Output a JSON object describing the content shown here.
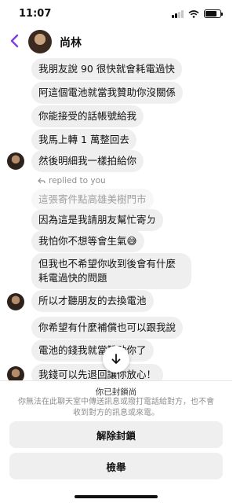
{
  "status": {
    "time": "11:07"
  },
  "header": {
    "name": "尚林",
    "back_icon": "chevron-left-icon"
  },
  "messages": [
    {
      "text": "我朋友說 90 很快就會耗電過快"
    },
    {
      "text": "阿這個電池就當我贊助你沒關係"
    },
    {
      "text": "你能接受的話帳號給我"
    },
    {
      "text": "我馬上轉 1 萬整回去"
    },
    {
      "text": "然後明細我一樣拍給你"
    },
    {
      "reply_label": "replied to you"
    },
    {
      "quoted": "這張寄件點高雄美樹門市"
    },
    {
      "text": "因為這是我請朋友幫忙寄ㄉ"
    },
    {
      "text": "我怕你不想等會生氣😅"
    },
    {
      "text": "但我也不希望你收到後會有什麼耗電過快的問題"
    },
    {
      "text": "所以才聽朋友的去換電池"
    },
    {
      "text": "你希望有什麼補償也可以跟我說"
    },
    {
      "text": "電池的錢我就當贊助你了"
    },
    {
      "text": "我錢可以先退回讓你放心！"
    }
  ],
  "blocked": {
    "title": "你已封鎖尚",
    "description": "你無法在此聊天室中傳送訊息或撥打電話給對方，也不會收到對方的訊息或來電。",
    "unblock_label": "解除封鎖",
    "report_label": "檢舉"
  },
  "colors": {
    "accent": "#7b3fe4",
    "bubble": "#efefef"
  }
}
